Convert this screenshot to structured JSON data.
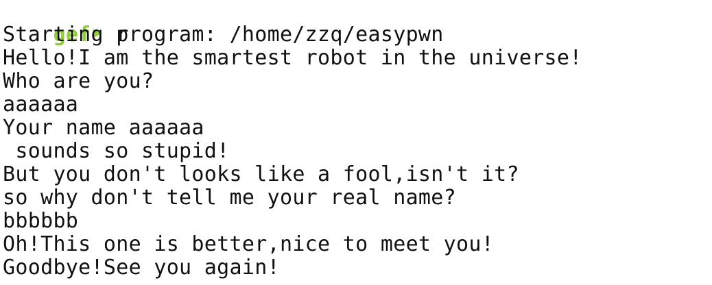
{
  "prompt": {
    "label": "gef",
    "arrow": "➤",
    "command": " r"
  },
  "output_lines": [
    "Starting program: /home/zzq/easypwn",
    "Hello!I am the smartest robot in the universe!",
    "Who are you?",
    "aaaaaa",
    "Your name aaaaaa",
    " sounds so stupid!",
    "But you don't looks like a fool,isn't it?",
    "so why don't tell me your real name?",
    "bbbbbb",
    "Oh!This one is better,nice to meet you!",
    "Goodbye!See you again!"
  ],
  "colors": {
    "prompt": "#8fce3a",
    "text": "#111111",
    "background": "#ffffff"
  }
}
